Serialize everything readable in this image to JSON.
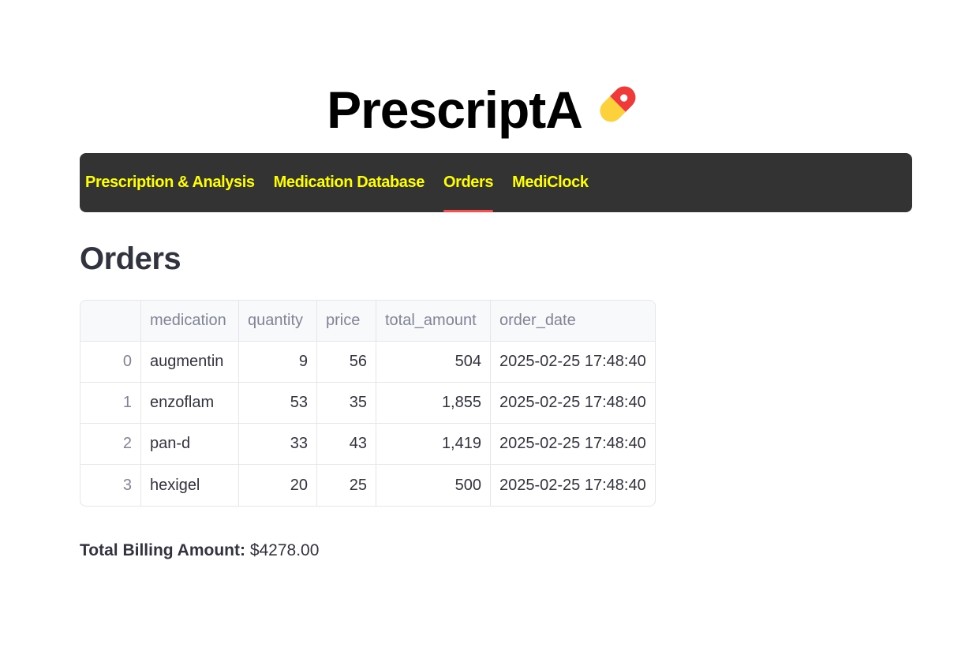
{
  "app": {
    "title": "PrescriptA",
    "title_icon": "pill-icon",
    "colors": {
      "nav_background": "#333333",
      "nav_text": "#ffff00",
      "active_underline": "#ff4b4b",
      "pill_red": "#f03a3a",
      "pill_yellow": "#fdd13c"
    }
  },
  "nav": {
    "tabs": [
      {
        "label": "Prescription & Analysis",
        "active": false
      },
      {
        "label": "Medication Database",
        "active": false
      },
      {
        "label": "Orders",
        "active": true
      },
      {
        "label": "MediClock",
        "active": false
      }
    ]
  },
  "orders": {
    "heading": "Orders",
    "columns": [
      "",
      "medication",
      "quantity",
      "price",
      "total_amount",
      "order_date"
    ],
    "rows": [
      {
        "index": "0",
        "medication": "augmentin",
        "quantity": "9",
        "price": "56",
        "total_amount": "504",
        "order_date": "2025-02-25 17:48:40"
      },
      {
        "index": "1",
        "medication": "enzoflam",
        "quantity": "53",
        "price": "35",
        "total_amount": "1,855",
        "order_date": "2025-02-25 17:48:40"
      },
      {
        "index": "2",
        "medication": "pan-d",
        "quantity": "33",
        "price": "43",
        "total_amount": "1,419",
        "order_date": "2025-02-25 17:48:40"
      },
      {
        "index": "3",
        "medication": "hexigel",
        "quantity": "20",
        "price": "25",
        "total_amount": "500",
        "order_date": "2025-02-25 17:48:40"
      }
    ]
  },
  "billing": {
    "label": "Total Billing Amount:",
    "value": "$4278.00"
  }
}
